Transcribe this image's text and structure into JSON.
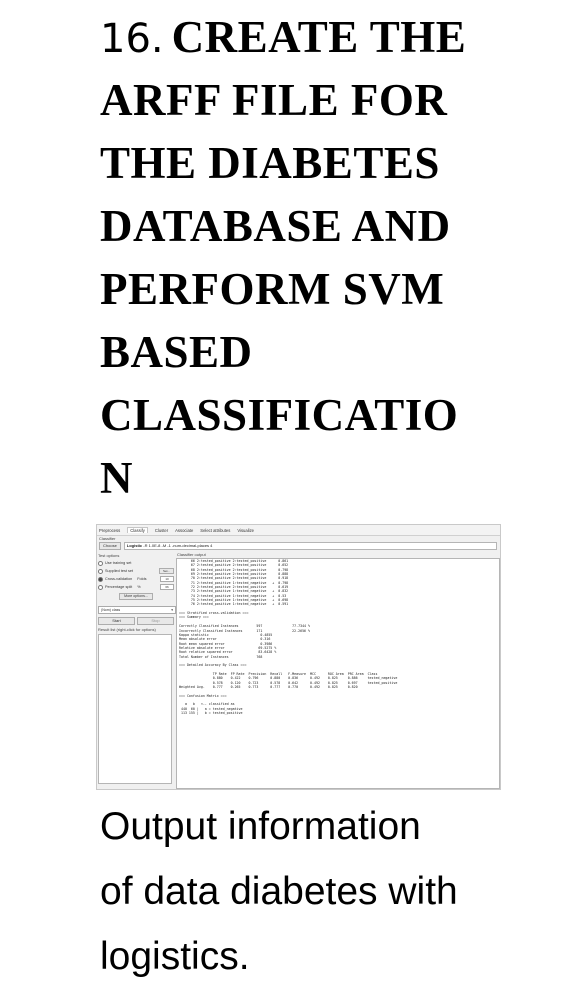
{
  "heading": {
    "number": "16.",
    "line1": "CREATE THE",
    "line2": "ARFF FILE FOR",
    "line3": "THE DIABETES",
    "line4": "DATABASE AND",
    "line5": "PERFORM SVM",
    "line6": "BASED",
    "line7": "CLASSIFICATIO",
    "line8": "N"
  },
  "weka": {
    "tabs": [
      "Preprocess",
      "Classify",
      "Cluster",
      "Associate",
      "Select attributes",
      "Visualize"
    ],
    "filter_label": "Classifier",
    "choose_label": "Choose",
    "classifier_name": "Logistic",
    "classifier_args": "-R 1.0E-8 -M -1 -num-decimal-places 4",
    "test_options_title": "Test options",
    "opt_training": "Use training set",
    "opt_supplied": "Supplied test set",
    "set_label": "Set...",
    "opt_cv": "Cross-validation",
    "folds_label": "Folds",
    "folds_value": "10",
    "opt_split": "Percentage split",
    "split_pct": "%",
    "split_value": "66",
    "more_options": "More options...",
    "class_value": "(Nom) class",
    "start_label": "Start",
    "stop_label": "Stop",
    "result_list_title": "Result list (right-click for options)",
    "output_title": "Classifier output",
    "output_lines": [
      "      66 2:tested_positive 2:tested_positive      0.861",
      "      67 2:tested_positive 2:tested_positive      0.652",
      "      68 2:tested_positive 2:tested_positive      0.798",
      "      69 2:tested_positive 2:tested_positive      0.888",
      "      70 2:tested_positive 2:tested_positive      0.918",
      "      71 2:tested_positive 1:tested_negative   +  0.798",
      "      72 2:tested_positive 2:tested_positive      0.619",
      "      73 2:tested_positive 1:tested_negative   +  0.832",
      "      74 2:tested_positive 1:tested_negative   +  0.53",
      "      75 2:tested_positive 1:tested_negative   +  0.698",
      "      76 2:tested_positive 1:tested_negative   +  0.591",
      "",
      "=== Stratified cross-validation ===",
      "=== Summary ===",
      "",
      "Correctly Classified Instances         597               77.7344 %",
      "Incorrectly Classified Instances       171               22.2656 %",
      "Kappa statistic                          0.4855",
      "Mean absolute error                      0.316",
      "Root mean squared error                  0.3986",
      "Relative absolute error                 69.5275 %",
      "Root relative squared error             83.6428 %",
      "Total Number of Instances              768",
      "",
      "=== Detailed Accuracy By Class ===",
      "",
      "                 TP Rate  FP Rate  Precision  Recall   F-Measure  MCC      ROC Area  PRC Area  Class",
      "                 0.880    0.422    0.796      0.880    0.836      0.492    0.825     0.886     tested_negative",
      "                 0.578    0.120    0.723      0.578    0.642      0.492    0.825     0.697     tested_positive",
      "Weighted Avg.    0.777    0.265    0.773      0.777    0.770      0.492    0.825     0.820",
      "",
      "=== Confusion Matrix ===",
      "",
      "   a   b   <-- classified as",
      " 440  60 |   a = tested_negative",
      " 113 155 |   b = tested_positive"
    ]
  },
  "caption": {
    "line1": "Output information",
    "line2": "of data diabetes with",
    "line3": "logistics."
  }
}
